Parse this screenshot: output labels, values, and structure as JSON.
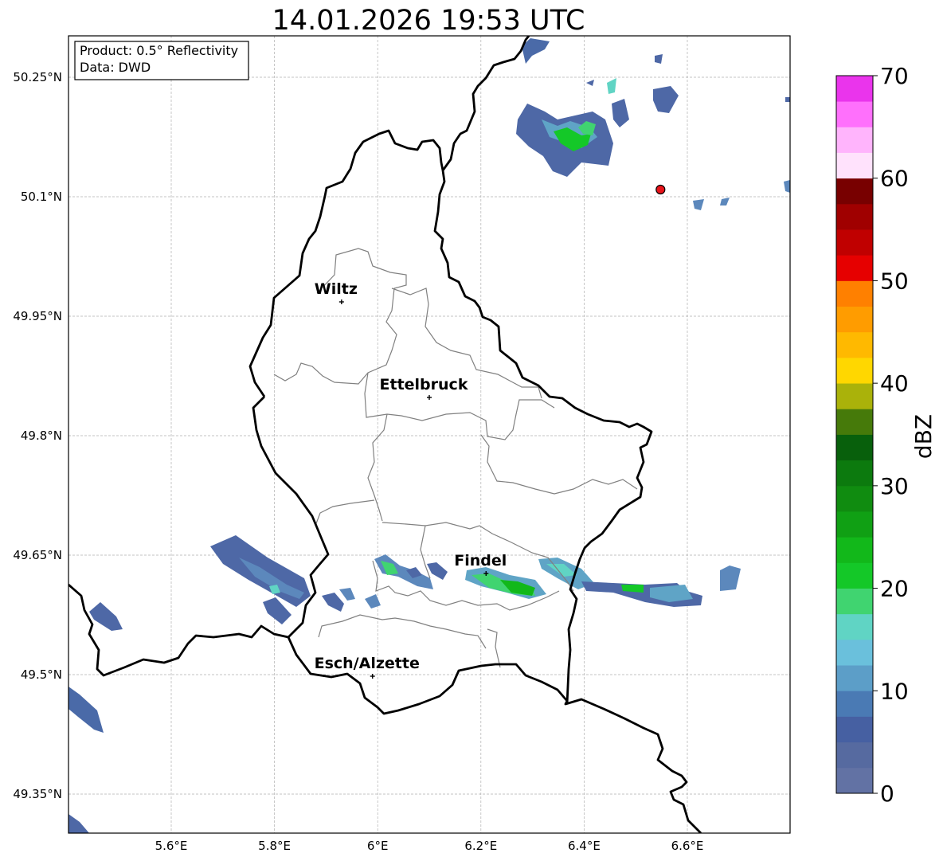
{
  "title": "14.01.2026 19:53 UTC",
  "info_box": {
    "product": "Product: 0.5° Reflectivity",
    "data": "Data: DWD"
  },
  "y_ticks": [
    "50.25°N",
    "50.1°N",
    "49.95°N",
    "49.8°N",
    "49.65°N",
    "49.5°N",
    "49.35°N"
  ],
  "x_ticks": [
    "5.6°E",
    "5.8°E",
    "6°E",
    "6.2°E",
    "6.4°E",
    "6.6°E"
  ],
  "cities": [
    {
      "name": "Wiltz",
      "lon": 5.93,
      "lat": 49.968
    },
    {
      "name": "Ettelbruck",
      "lon": 6.1,
      "lat": 49.848
    },
    {
      "name": "Findel",
      "lon": 6.21,
      "lat": 49.627
    },
    {
      "name": "Esch/Alzette",
      "lon": 5.99,
      "lat": 49.498
    }
  ],
  "radar_marker": {
    "lon": 6.548,
    "lat": 50.109,
    "color": "#e8141a"
  },
  "colorbar": {
    "label": "dBZ",
    "tick_labels": [
      "0",
      "10",
      "20",
      "30",
      "40",
      "50",
      "60",
      "70"
    ],
    "min": 0,
    "max": 70,
    "step": 2.5,
    "colors": [
      "#6272a4",
      "#566aa0",
      "#4660a2",
      "#4a7ab4",
      "#5c9ec8",
      "#6ac0dc",
      "#60d4c4",
      "#40d470",
      "#14c828",
      "#12b81a",
      "#10a014",
      "#108c10",
      "#0c7a0e",
      "#08600c",
      "#467a0a",
      "#aab20a",
      "#ffd700",
      "#ffb900",
      "#ff9c00",
      "#ff8000",
      "#e60000",
      "#c00000",
      "#a00000",
      "#780000",
      "#ffe2fc",
      "#ffb4fc",
      "#ff70fc",
      "#ea34ec"
    ]
  }
}
